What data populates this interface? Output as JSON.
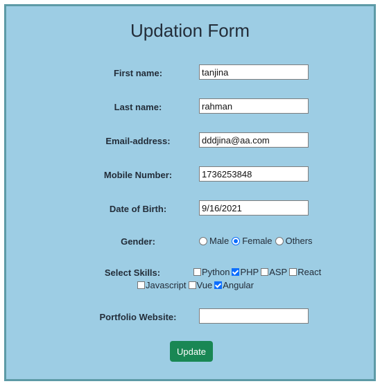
{
  "title": "Updation Form",
  "fields": {
    "first_name": {
      "label": "First name:",
      "value": "tanjina"
    },
    "last_name": {
      "label": "Last name:",
      "value": "rahman"
    },
    "email": {
      "label": "Email-address:",
      "value": "dddjina@aa.com"
    },
    "mobile": {
      "label": "Mobile Number:",
      "value": "1736253848"
    },
    "dob": {
      "label": "Date of Birth:",
      "value": "9/16/2021"
    },
    "portfolio": {
      "label": "Portfolio Website:",
      "value": ""
    }
  },
  "gender": {
    "label": "Gender:",
    "options": [
      "Male",
      "Female",
      "Others"
    ],
    "selected": "Female"
  },
  "skills": {
    "label": "Select Skills:",
    "options": [
      "Python",
      "PHP",
      "ASP",
      "React",
      "Javascript",
      "Vue",
      "Angular"
    ],
    "checked": [
      "PHP",
      "Angular"
    ]
  },
  "submit_label": "Update",
  "colors": {
    "background": "#9dcde4",
    "border": "#5d9aa6",
    "button": "#198754",
    "accent": "#0d6efd"
  }
}
